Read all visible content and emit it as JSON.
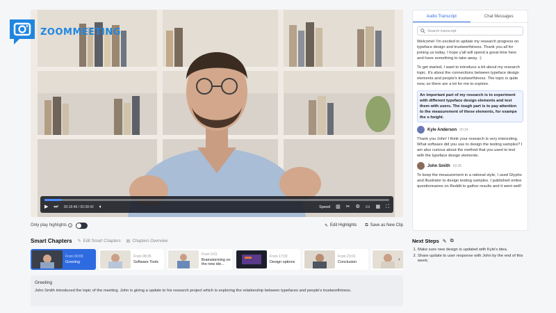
{
  "brand": {
    "name": "ZOOMMEETING"
  },
  "player": {
    "current_time": "00:18:48",
    "duration": "00:38:42",
    "speed_label": "Speed",
    "progress": 0.05
  },
  "under_bar": {
    "highlights_toggle_label": "Only play highlights",
    "edit_highlights": "Edit Highlights",
    "save_clip": "Save as New Clip"
  },
  "chapters_section": {
    "title": "Smart Chapters",
    "edit_label": "Edit Smart Chapters",
    "overview_label": "Chapters Overview",
    "items": [
      {
        "from": "From 00:00",
        "name": "Greeting",
        "active": true
      },
      {
        "from": "From 08:35",
        "name": "Software Tools",
        "active": false
      },
      {
        "from": "From 9:01",
        "name": "Brainstorming on the new ide...",
        "active": false
      },
      {
        "from": "From 17:03",
        "name": "Design options",
        "active": false
      },
      {
        "from": "From 23:01",
        "name": "Conclusion",
        "active": false
      }
    ]
  },
  "summary": {
    "title": "Greeting",
    "text": "John Smith introduced the topic of the meeting. John is giving a  update to his research project which is exploring the relationship between typefaces and people's trustworthiness."
  },
  "panel": {
    "tabs": [
      "Audio Transcript",
      "Chat Messages"
    ],
    "search_placeholder": "Search transcript",
    "p1": "Welcome! I'm excited to update my research progress on typeface design and trustworthiness. Thank you all for joining us today. I hope y'all will spend a great time here and have something to take away. :)",
    "p2": "To get started, I want to introduce a bit about my research topic. It's about the connections between typeface design elements and people's trustworthiness. The topic is quite new, so there are a lot for me to explore.",
    "p3": "An important part of my research is to experiment with different typeface design elements and test them with users. The tough part is to pay attention to the measurement of these elements, for exampe the x-height.",
    "speaker1": {
      "name": "Kyle Anderson",
      "time": "00:34"
    },
    "p4": "Thank you John! I think your research is very interesting. What software did you use to design the testing samples? I am also curious about the method that you used to test with the typeface design elements.",
    "speaker2": {
      "name": "John Smith",
      "time": "00:35"
    },
    "p5": "To keep the measurement in a rational style, I used Glyphs and Illustrator to design testing samples. I published online questionnaires on Reddit to gather results and it went well!"
  },
  "next_steps": {
    "title": "Next Steps",
    "items": [
      "Make sure new design is updated with Kyle's idea.",
      "Share update to user response with John by the end of this week;"
    ]
  },
  "colors": {
    "accent": "#2f6be0",
    "brand": "#1f86e0"
  }
}
